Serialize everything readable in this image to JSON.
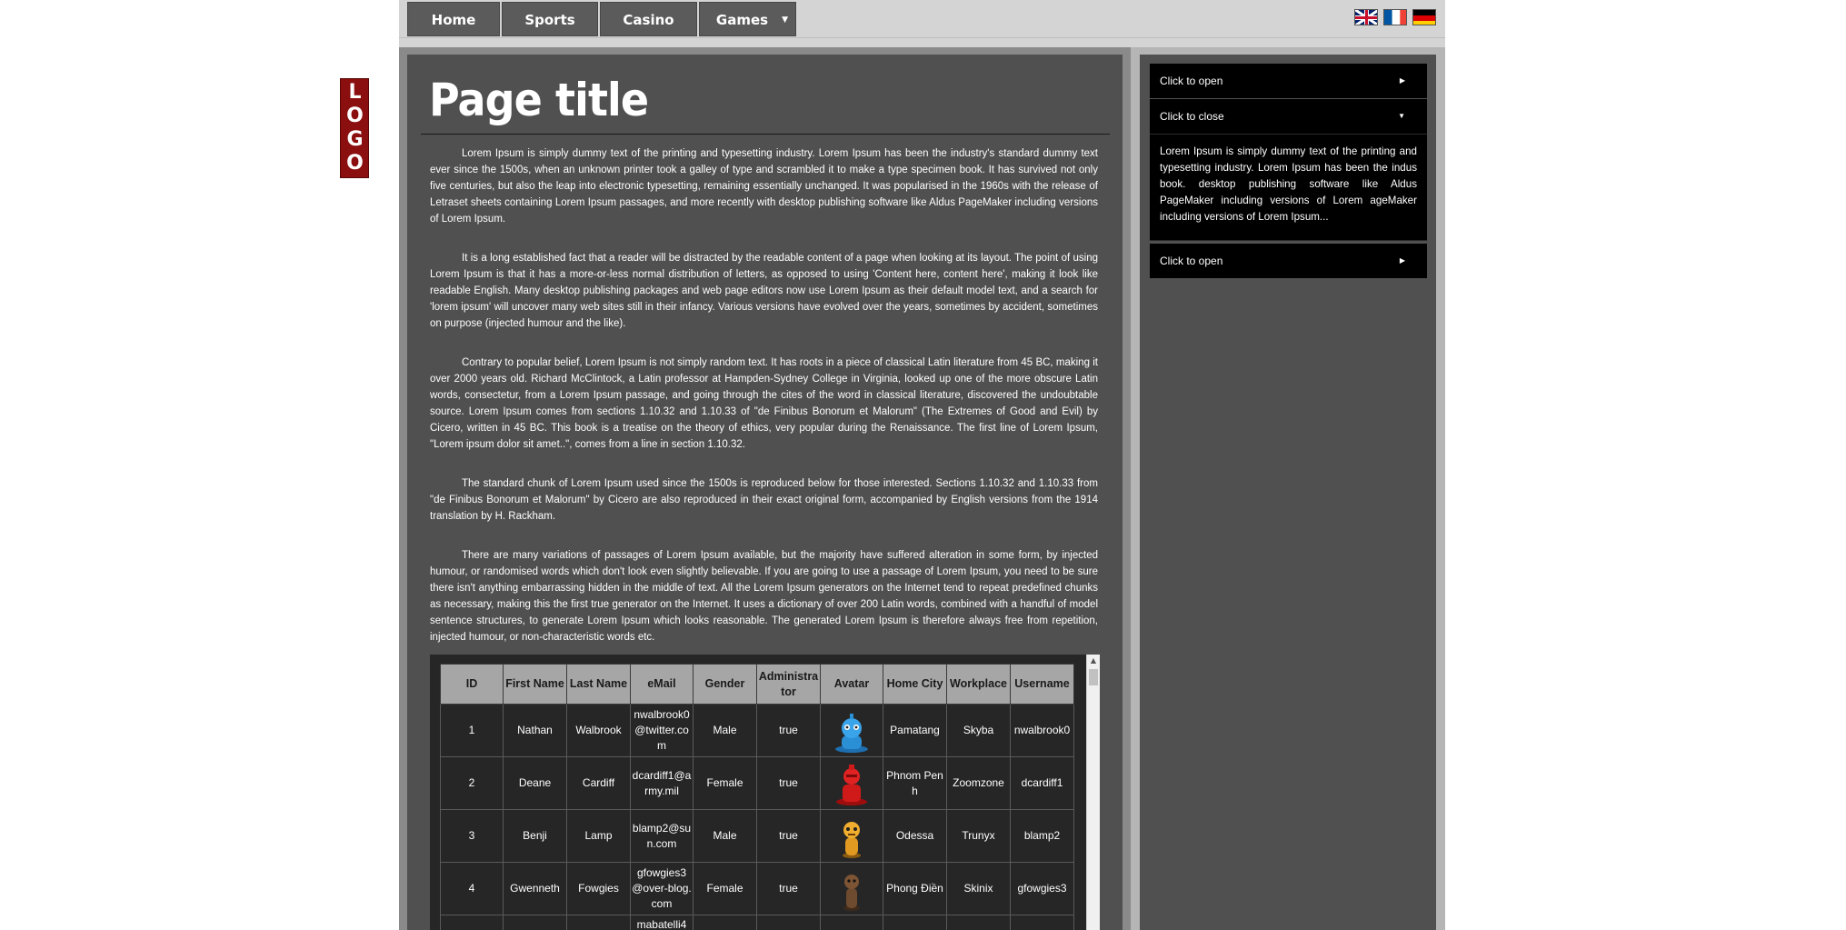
{
  "logo": {
    "text": "LOGO",
    "color": "#8b0f0f"
  },
  "nav": {
    "items": [
      {
        "label": "Home"
      },
      {
        "label": "Sports"
      },
      {
        "label": "Casino"
      },
      {
        "label": "Games",
        "has_dropdown": true
      }
    ],
    "languages": [
      "English",
      "Français",
      "Deutsch"
    ]
  },
  "main": {
    "title": "Page title",
    "paragraphs": [
      "Lorem Ipsum is simply dummy text of the printing and typesetting industry. Lorem Ipsum has been the industry's standard dummy text ever since the 1500s, when an unknown printer took a galley of type and scrambled it to make a type specimen book. It has survived not only five centuries, but also the leap into electronic typesetting, remaining essentially unchanged. It was popularised in the 1960s with the release of Letraset sheets containing Lorem Ipsum passages, and more recently with desktop publishing software like Aldus PageMaker including versions of Lorem Ipsum.",
      "It is a long established fact that a reader will be distracted by the readable content of a page when looking at its layout. The point of using Lorem Ipsum is that it has a more-or-less normal distribution of letters, as opposed to using 'Content here, content here', making it look like readable English. Many desktop publishing packages and web page editors now use Lorem Ipsum as their default model text, and a search for 'lorem ipsum' will uncover many web sites still in their infancy. Various versions have evolved over the years, sometimes by accident, sometimes on purpose (injected humour and the like).",
      "Contrary to popular belief, Lorem Ipsum is not simply random text. It has roots in a piece of classical Latin literature from 45 BC, making it over 2000 years old. Richard McClintock, a Latin professor at Hampden-Sydney College in Virginia, looked up one of the more obscure Latin words, consectetur, from a Lorem Ipsum passage, and going through the cites of the word in classical literature, discovered the undoubtable source. Lorem Ipsum comes from sections 1.10.32 and 1.10.33 of \"de Finibus Bonorum et Malorum\" (The Extremes of Good and Evil) by Cicero, written in 45 BC. This book is a treatise on the theory of ethics, very popular during the Renaissance. The first line of Lorem Ipsum, \"Lorem ipsum dolor sit amet..\", comes from a line in section 1.10.32.",
      "The standard chunk of Lorem Ipsum used since the 1500s is reproduced below for those interested. Sections 1.10.32 and 1.10.33 from \"de Finibus Bonorum et Malorum\" by Cicero are also reproduced in their exact original form, accompanied by English versions from the 1914 translation by H. Rackham.",
      "There are many variations of passages of Lorem Ipsum available, but the majority have suffered alteration in some form, by injected humour, or randomised words which don't look even slightly believable. If you are going to use a passage of Lorem Ipsum, you need to be sure there isn't anything embarrassing hidden in the middle of text. All the Lorem Ipsum generators on the Internet tend to repeat predefined chunks as necessary, making this the first true generator on the Internet. It uses a dictionary of over 200 Latin words, combined with a handful of model sentence structures, to generate Lorem Ipsum which looks reasonable. The generated Lorem Ipsum is therefore always free from repetition, injected humour, or non-characteristic words etc."
    ],
    "table": {
      "headers": [
        "ID",
        "First Name",
        "Last Name",
        "eMail",
        "Gender",
        "Administrator",
        "Avatar",
        "Home City",
        "Workplace",
        "Username"
      ],
      "rows": [
        {
          "id": "1",
          "first": "Nathan",
          "last": "Walbrook",
          "email": "nwalbrook0@twitter.com",
          "gender": "Male",
          "admin": "true",
          "avatar": "blue-robot-avatar",
          "city": "Pamatang",
          "work": "Skyba",
          "username": "nwalbrook0"
        },
        {
          "id": "2",
          "first": "Deane",
          "last": "Cardiff",
          "email": "dcardiff1@army.mil",
          "gender": "Female",
          "admin": "true",
          "avatar": "red-robot-avatar",
          "city": "Phnom Penh",
          "work": "Zoomzone",
          "username": "dcardiff1"
        },
        {
          "id": "3",
          "first": "Benji",
          "last": "Lamp",
          "email": "blamp2@sun.com",
          "gender": "Male",
          "admin": "true",
          "avatar": "orange-robot-avatar",
          "city": "Odessa",
          "work": "Trunyx",
          "username": "blamp2"
        },
        {
          "id": "4",
          "first": "Gwenneth",
          "last": "Fowgies",
          "email": "gfowgies3@over-blog.com",
          "gender": "Female",
          "admin": "true",
          "avatar": "brown-robot-avatar",
          "city": "Phong Điền",
          "work": "Skinix",
          "username": "gfowgies3"
        },
        {
          "id": "",
          "first": "",
          "last": "",
          "email": "mabatelli4",
          "gender": "",
          "admin": "",
          "avatar": "",
          "city": "",
          "work": "",
          "username": ""
        }
      ]
    }
  },
  "sidebar": {
    "accordion": [
      {
        "label": "Click to open",
        "state": "closed"
      },
      {
        "label": "Click to close",
        "state": "open",
        "body": "Lorem Ipsum is simply dummy text of the printing and typesetting industry. Lorem Ipsum has been the indus book. desktop publishing software like Aldus PageMaker including versions of Lorem ageMaker including versions of Lorem Ipsum..."
      },
      {
        "label": "Click to open",
        "state": "closed"
      }
    ]
  }
}
